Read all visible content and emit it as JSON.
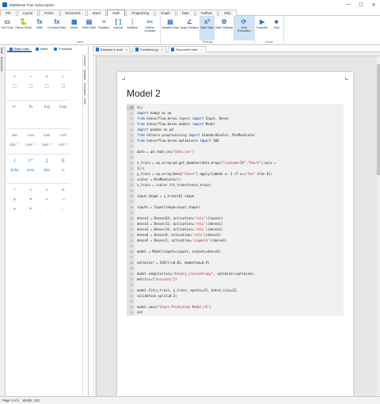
{
  "window": {
    "title": "MathDesk Free Subscription",
    "controls": [
      "—",
      "☐",
      "✕"
    ]
  },
  "menu_tabs": [
    {
      "label": "File"
    },
    {
      "label": "Layout"
    },
    {
      "label": "Home"
    },
    {
      "label": "Document"
    },
    {
      "label": "Insert"
    },
    {
      "label": "Math",
      "active": true
    },
    {
      "label": "Programing"
    },
    {
      "label": "Graph"
    },
    {
      "label": "Data"
    },
    {
      "label": "Toolbox"
    },
    {
      "label": "Help"
    }
  ],
  "ribbon": {
    "groups": [
      {
        "label": "Insert",
        "buttons": [
          {
            "label": "Text Code",
            "icon": "text-code-icon",
            "glyph": "▭",
            "color": "#555555"
          },
          {
            "label": "Python Block",
            "icon": "python-icon",
            "glyph": "🐍",
            "color": "#e0a800"
          },
          {
            "label": "Math",
            "icon": "math-icon",
            "glyph": "fx",
            "color": "#2a73c9"
          },
          {
            "label": "Formula Editor",
            "icon": "formula-editor-icon",
            "glyph": "fx",
            "color": "#2a73c9"
          },
          {
            "label": "Matrix",
            "icon": "matrix-icon",
            "glyph": "▦",
            "color": "#2a73c9"
          },
          {
            "label": "Math Table",
            "icon": "math-table-icon",
            "glyph": "▤",
            "color": "#2a73c9"
          },
          {
            "label": "Equation",
            "icon": "equation-icon",
            "glyph": "≡",
            "color": "#2a73c9"
          },
          {
            "label": "Interval",
            "icon": "interval-icon",
            "glyph": "[ ]",
            "color": "#2a73c9"
          },
          {
            "label": "Multiline",
            "icon": "multiline-icon",
            "glyph": "⋮",
            "color": "#2a73c9"
          },
          {
            "label": "Define Constant",
            "icon": "define-constant-icon",
            "glyph": "≔",
            "color": "#2a73c9"
          }
        ]
      },
      {
        "label": "Settings",
        "buttons": [
          {
            "label": "Variable Data",
            "icon": "variable-data-icon",
            "glyph": "▤",
            "color": "#2a73c9"
          },
          {
            "label": "Angle Radians",
            "icon": "angle-radians-icon",
            "glyph": "∠",
            "color": "#2a73c9"
          },
          {
            "label": "Math Style",
            "icon": "math-style-icon",
            "glyph": "x²",
            "color": "#2a73c9",
            "pressed": true
          },
          {
            "label": "Math Settings",
            "icon": "math-settings-icon",
            "glyph": "⚙",
            "color": "#2a73c9"
          },
          {
            "label": "Auto Evaluation",
            "icon": "auto-evaluation-icon",
            "glyph": "⟳",
            "color": "#2a73c9",
            "pressed": true
          }
        ]
      },
      {
        "label": "Script",
        "buttons": [
          {
            "label": "Evaluate",
            "icon": "evaluate-icon",
            "glyph": "▶",
            "color": "#2a73c9"
          },
          {
            "label": "Stop",
            "icon": "stop-icon",
            "glyph": "■",
            "color": "#2a73c9"
          }
        ]
      }
    ]
  },
  "left_strip_tabs": [
    "Math",
    "Documents"
  ],
  "left_panel": {
    "tabs": [
      {
        "label": "Basic math",
        "active": true
      },
      {
        "label": "Insert"
      },
      {
        "label": "Functions"
      }
    ],
    "vertical_tabs": [
      "Common",
      "Symbols",
      "Constants",
      "Units"
    ],
    "symbol_groups": [
      [
        "+",
        "−",
        "×",
        "÷",
        "□",
        "□",
        "□",
        "□"
      ],
      [
        "eˣ",
        "ln",
        "log",
        "logᵦ"
      ],
      [
        "sin",
        "cos",
        "tan",
        "cot",
        "sin⁻¹",
        "cos⁻¹",
        "tan⁻¹",
        "cot⁻¹"
      ],
      [
        "∫",
        "∫ᵃᵇ",
        "∑",
        "∏",
        "d/dx",
        "∂/∂x",
        "lim",
        "∞"
      ],
      [
        "=",
        "<",
        ">",
        "≤",
        "≥",
        "≠",
        "≈",
        "→",
        "±",
        "∓",
        "·",
        "…"
      ]
    ]
  },
  "doc_tabs": [
    {
      "label": "Example 1.mdd"
    },
    {
      "label": "Functions.py"
    },
    {
      "label": "Document.mdd",
      "active": true
    }
  ],
  "document": {
    "heading": "Model 2",
    "code_lines": [
      {
        "n": "20",
        "segments": [
          {
            "t": "#py",
            "c": "cmt"
          }
        ]
      },
      {
        "n": "21",
        "segments": [
          {
            "t": "import",
            "c": "kw"
          },
          {
            "t": " numpy as np"
          }
        ]
      },
      {
        "n": "22",
        "segments": [
          {
            "t": "from",
            "c": "kw"
          },
          {
            "t": " tensorflow.keras.layers "
          },
          {
            "t": "import",
            "c": "kw"
          },
          {
            "t": " Input, Dense"
          }
        ]
      },
      {
        "n": "23",
        "segments": [
          {
            "t": "from",
            "c": "kw"
          },
          {
            "t": " tensorflow.keras.models "
          },
          {
            "t": "import",
            "c": "kw"
          },
          {
            "t": " Model"
          }
        ]
      },
      {
        "n": "24",
        "segments": [
          {
            "t": "import",
            "c": "kw"
          },
          {
            "t": " pandas as pd"
          }
        ]
      },
      {
        "n": "25",
        "segments": [
          {
            "t": "from",
            "c": "kw"
          },
          {
            "t": " sklearn.preprocessing "
          },
          {
            "t": "import",
            "c": "kw"
          },
          {
            "t": " StandardScaler, MinMaxScaler"
          }
        ]
      },
      {
        "n": "26",
        "segments": [
          {
            "t": "from",
            "c": "kw"
          },
          {
            "t": " tensorflow.keras.optimizers "
          },
          {
            "t": "import",
            "c": "kw"
          },
          {
            "t": " SGD"
          }
        ]
      },
      {
        "n": "27",
        "segments": []
      },
      {
        "n": "28",
        "segments": [
          {
            "t": "data = pd.read_csv("
          },
          {
            "t": "\"data.csv\"",
            "c": "str"
          },
          {
            "t": ")"
          }
        ]
      },
      {
        "n": "29",
        "segments": []
      },
      {
        "n": "30",
        "segments": [
          {
            "t": "x_train = np.array(pd.get_dummies(data.drop(["
          },
          {
            "t": "\"customerID\"",
            "c": "str"
          },
          {
            "t": ","
          },
          {
            "t": "\"Churn\"",
            "c": "str"
          },
          {
            "t": "],axis ="
          }
        ]
      },
      {
        "n": "31",
        "segments": [
          {
            "t": "1)))"
          }
        ]
      },
      {
        "n": "32",
        "segments": [
          {
            "t": "y_train = np.array(data["
          },
          {
            "t": "\"Churn\"",
            "c": "str"
          },
          {
            "t": "].apply(lambda x: 1 if x=="
          },
          {
            "t": "\"Yes\"",
            "c": "str"
          },
          {
            "t": " else 0))"
          }
        ]
      },
      {
        "n": "33",
        "segments": [
          {
            "t": "scaler = MinMaxScaler()"
          }
        ]
      },
      {
        "n": "34",
        "segments": [
          {
            "t": "x_train = scaler.fit_transform(x_train)"
          }
        ]
      },
      {
        "n": "35",
        "segments": []
      },
      {
        "n": "36",
        "segments": [
          {
            "t": "input_shape = x_train[0].shape"
          }
        ]
      },
      {
        "n": "37",
        "segments": []
      },
      {
        "n": "38",
        "segments": [
          {
            "t": "inputs = Input(shape=input_shape)"
          }
        ]
      },
      {
        "n": "39",
        "segments": []
      },
      {
        "n": "40",
        "segments": [
          {
            "t": "dense1 = Dense(64, activation="
          },
          {
            "t": "\"relu\"",
            "c": "str"
          },
          {
            "t": ")(inputs)"
          }
        ]
      },
      {
        "n": "41",
        "segments": [
          {
            "t": "dense2 = Dense(32, activation="
          },
          {
            "t": "'relu'",
            "c": "str"
          },
          {
            "t": ")(dense1)"
          }
        ]
      },
      {
        "n": "42",
        "segments": [
          {
            "t": "dense3 = Dense(16, activation="
          },
          {
            "t": "'relu'",
            "c": "str"
          },
          {
            "t": ")(dense2)"
          }
        ]
      },
      {
        "n": "43",
        "segments": [
          {
            "t": "dense4 = Dense(8, activation="
          },
          {
            "t": "'relu'",
            "c": "str"
          },
          {
            "t": ")(dense3)"
          }
        ]
      },
      {
        "n": "44",
        "segments": [
          {
            "t": "dense5 = Dense(1, activation="
          },
          {
            "t": "'sigmoid'",
            "c": "str"
          },
          {
            "t": ")(dense4)"
          }
        ]
      },
      {
        "n": "45",
        "segments": []
      },
      {
        "n": "46",
        "segments": [
          {
            "t": "model = Model(inputs=inputs, outputs=dense5)"
          }
        ]
      },
      {
        "n": "47",
        "segments": []
      },
      {
        "n": "48",
        "segments": [
          {
            "t": "optimizer = SGD(lr=0.01, momentum=0.9)"
          }
        ]
      },
      {
        "n": "49",
        "segments": []
      },
      {
        "n": "50",
        "segments": [
          {
            "t": "model.compile(loss="
          },
          {
            "t": "\"binary_crossentropy\"",
            "c": "str"
          },
          {
            "t": ", optimizer=optimizer,"
          }
        ]
      },
      {
        "n": "51",
        "segments": [
          {
            "t": "metrics=["
          },
          {
            "t": "\"accuracy\"",
            "c": "str"
          },
          {
            "t": "])"
          }
        ]
      },
      {
        "n": "52",
        "segments": []
      },
      {
        "n": "53",
        "segments": [
          {
            "t": "model.fit(x_train, y_train, epochs=25, batch_size=32,"
          }
        ]
      },
      {
        "n": "54",
        "segments": [
          {
            "t": "validation_split=0.3)"
          }
        ]
      },
      {
        "n": "55",
        "segments": []
      },
      {
        "n": "56",
        "segments": [
          {
            "t": "model.save("
          },
          {
            "t": "\"Churn Prediction Model.h5\"",
            "c": "str"
          },
          {
            "t": ")"
          }
        ]
      },
      {
        "n": "57",
        "segments": [
          {
            "t": "###",
            "c": "cmt"
          }
        ]
      }
    ]
  },
  "status": {
    "page": "Page 1 of 1",
    "words": "Words: 130"
  }
}
